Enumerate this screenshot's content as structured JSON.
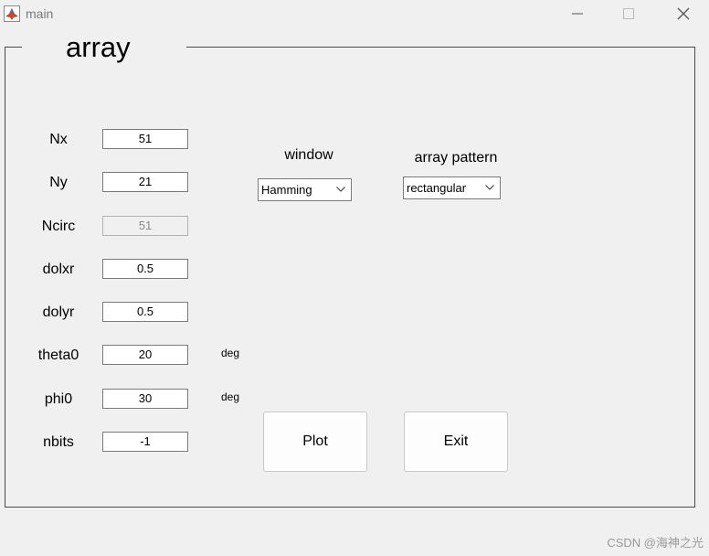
{
  "window": {
    "title": "main",
    "app_icon": "matlab-icon",
    "controls": [
      "minimize-icon",
      "maximize-icon",
      "close-icon"
    ]
  },
  "panel": {
    "title": "array"
  },
  "fields": [
    {
      "label": "Nx",
      "value": "51",
      "enabled": true
    },
    {
      "label": "Ny",
      "value": "21",
      "enabled": true
    },
    {
      "label": "Ncirc",
      "value": "51",
      "enabled": false
    },
    {
      "label": "dolxr",
      "value": "0.5",
      "enabled": true
    },
    {
      "label": "dolyr",
      "value": "0.5",
      "enabled": true
    },
    {
      "label": "theta0",
      "value": "20",
      "enabled": true,
      "unit": "deg"
    },
    {
      "label": "phi0",
      "value": "30",
      "enabled": true,
      "unit": "deg"
    },
    {
      "label": "nbits",
      "value": "-1",
      "enabled": true
    }
  ],
  "window_select": {
    "label": "window",
    "value": "Hamming"
  },
  "pattern_select": {
    "label": "array pattern",
    "value": "rectangular"
  },
  "buttons": {
    "plot": "Plot",
    "exit": "Exit"
  },
  "watermark": "CSDN @海神之光"
}
